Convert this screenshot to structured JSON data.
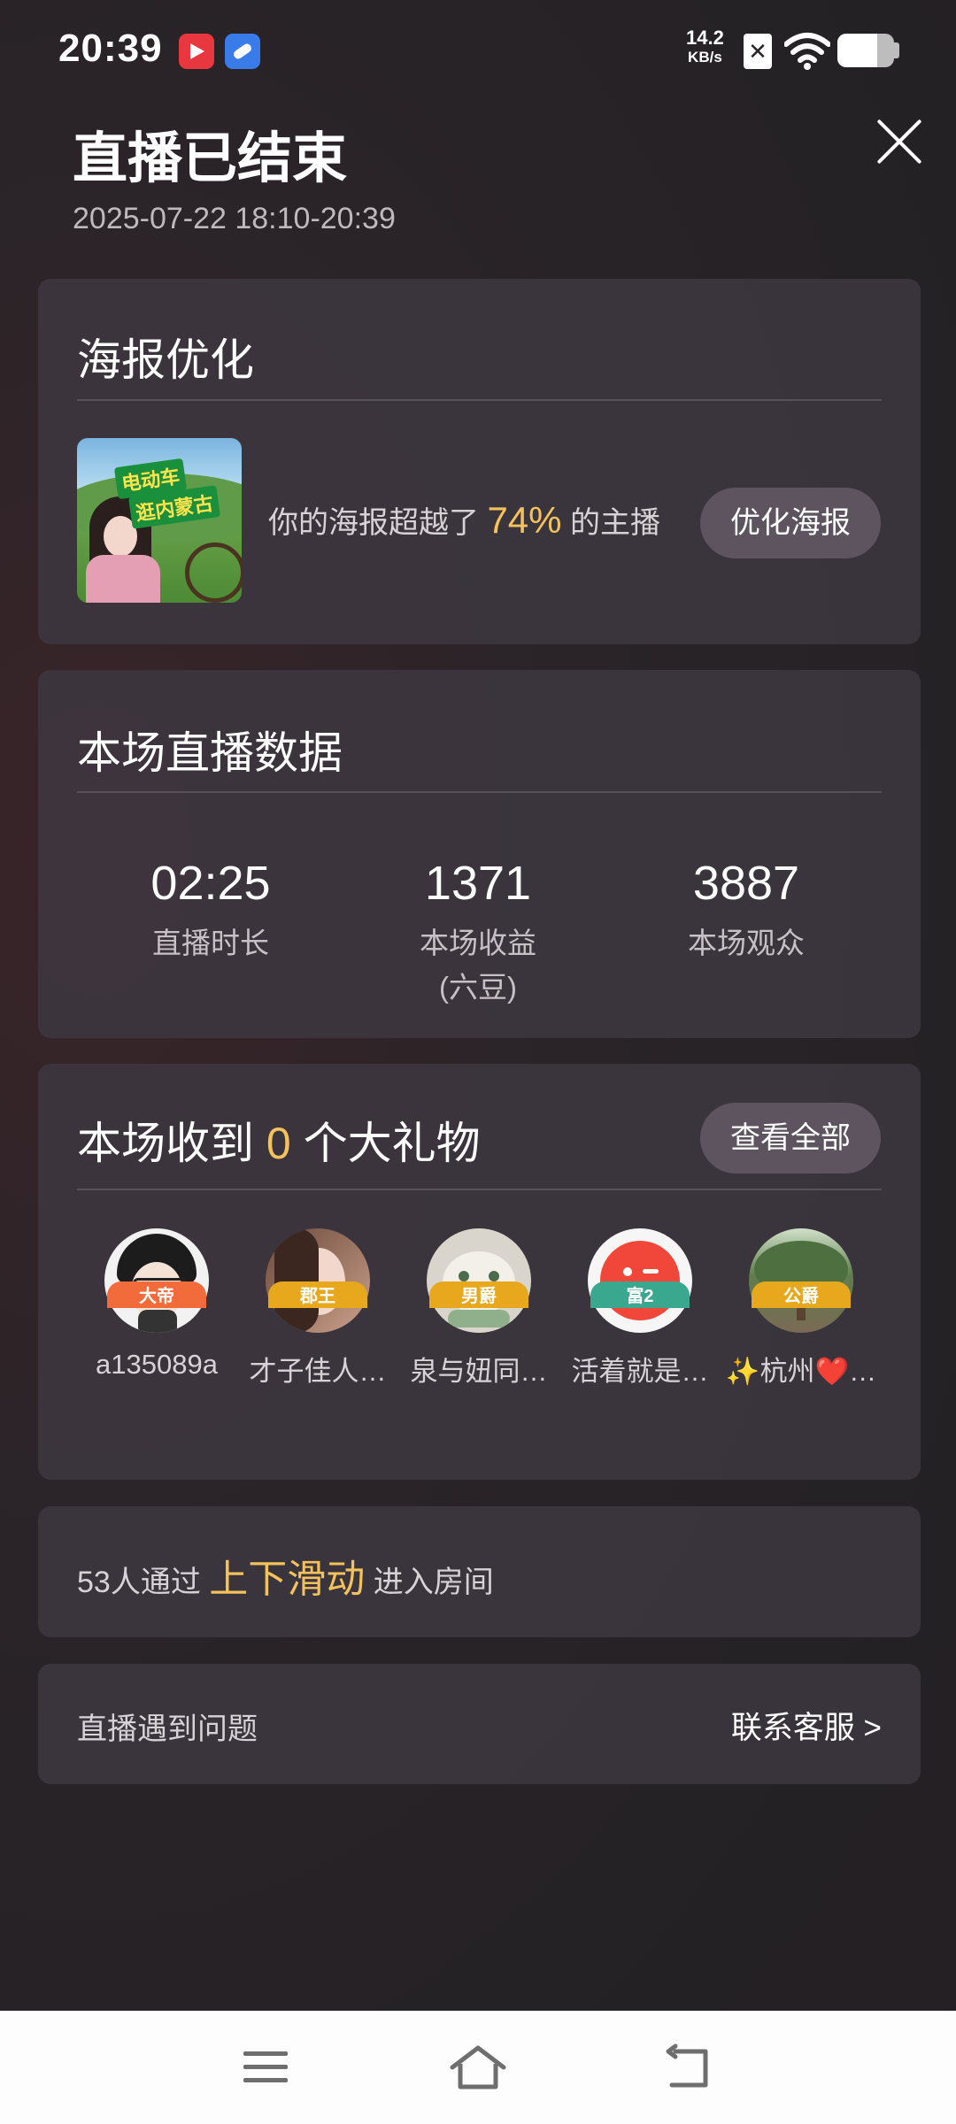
{
  "status_bar": {
    "time": "20:39",
    "net_speed_value": "14.2",
    "net_speed_unit": "KB/s",
    "sim_glyph": "✕",
    "battery_level": 0.7,
    "icons": [
      "video-app-icon",
      "notes-app-icon",
      "sim-off-icon",
      "wifi-icon",
      "battery-icon"
    ]
  },
  "header": {
    "title": "直播已结束",
    "time_range": "2025-07-22 18:10-20:39"
  },
  "poster": {
    "title": "海报优化",
    "text_prefix": "你的海报超越了",
    "percent": "74%",
    "text_suffix": "的主播",
    "button": "优化海报",
    "thumb_caption_1": "电动车",
    "thumb_caption_2": "逛内蒙古"
  },
  "stats": {
    "title": "本场直播数据",
    "items": [
      {
        "value": "02:25",
        "label": "直播时长",
        "sublabel": ""
      },
      {
        "value": "1371",
        "label": "本场收益",
        "sublabel": "(六豆)"
      },
      {
        "value": "3887",
        "label": "本场观众",
        "sublabel": ""
      }
    ]
  },
  "gifts": {
    "title_prefix": "本场收到",
    "count": "0",
    "title_suffix": "个大礼物",
    "view_all": "查看全部",
    "gifters": [
      {
        "name": "a135089a",
        "badge": "大帝",
        "badge_color": "#f26b3a"
      },
      {
        "name": "才子佳人…",
        "badge": "郡王",
        "badge_color": "#e8a81e"
      },
      {
        "name": "泉与妞同…",
        "badge": "男爵",
        "badge_color": "#e8a81e"
      },
      {
        "name": "活着就是…",
        "badge": "富2",
        "badge_color": "#3aa88f"
      },
      {
        "name": "✨杭州❤️…",
        "badge": "公爵",
        "badge_color": "#e8a81e"
      }
    ]
  },
  "swipe": {
    "prefix": "53人通过",
    "highlight": "上下滑动",
    "suffix": "进入房间"
  },
  "support": {
    "label": "直播遇到问题",
    "link": "联系客服 >"
  },
  "colors": {
    "highlight": "#f4c25d",
    "card_bg": "#3e3842",
    "pill_bg": "#5d5460"
  }
}
